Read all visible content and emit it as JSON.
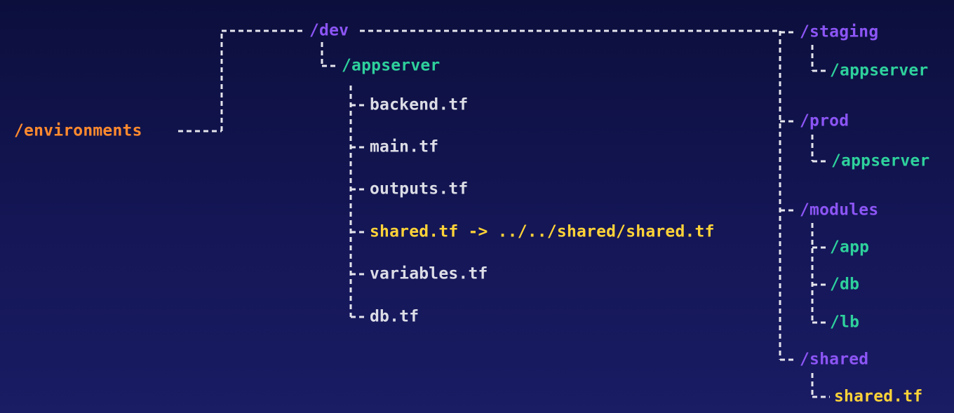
{
  "colors": {
    "background": "#141656",
    "connector": "#e4e4ec",
    "root": "#ff8a2e",
    "environment": "#8c55f5",
    "app_dir": "#2ed19c",
    "file": "#dcdde6",
    "symlink": "#ffd338"
  },
  "tree": {
    "root": "/environments",
    "dev": {
      "label": "/dev",
      "appserver": {
        "label": "/appserver",
        "files": [
          "backend.tf",
          "main.tf",
          "outputs.tf",
          "shared.tf -> ../../shared/shared.tf",
          "variables.tf",
          "db.tf"
        ]
      }
    },
    "staging": {
      "label": "/staging",
      "appserver": "/appserver"
    },
    "prod": {
      "label": "/prod",
      "appserver": "/appserver"
    },
    "modules": {
      "label": "/modules",
      "children": [
        "/app",
        "/db",
        "/lb"
      ]
    },
    "shared": {
      "label": "/shared",
      "file": "shared.tf"
    }
  }
}
